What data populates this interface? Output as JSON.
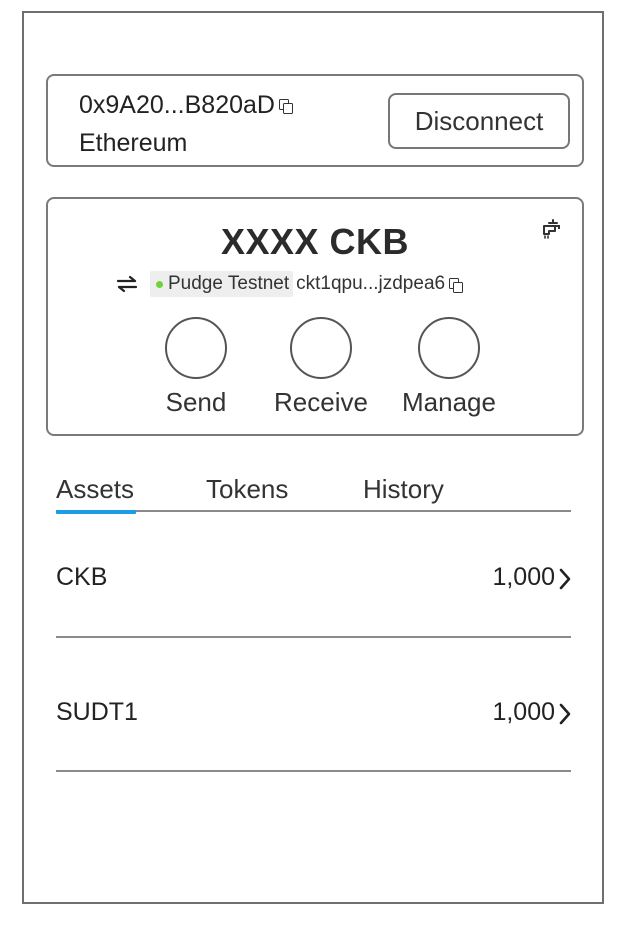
{
  "account": {
    "address": "0x9A20...B820aD",
    "chain": "Ethereum",
    "disconnect_label": "Disconnect"
  },
  "wallet": {
    "balance": "XXXX CKB",
    "network": "Pudge Testnet",
    "network_status_color": "#6ed33a",
    "ckb_address": "ckt1qpu...jzdpea6",
    "actions": [
      {
        "label": "Send",
        "icon": "send-circle"
      },
      {
        "label": "Receive",
        "icon": "receive-circle"
      },
      {
        "label": "Manage",
        "icon": "manage-circle"
      }
    ]
  },
  "tabs": [
    {
      "label": "Assets",
      "active": true
    },
    {
      "label": "Tokens",
      "active": false
    },
    {
      "label": "History",
      "active": false
    }
  ],
  "tab_accent": "#1e9be8",
  "assets": [
    {
      "name": "CKB",
      "value": "1,000"
    },
    {
      "name": "SUDT1",
      "value": "1,000"
    }
  ]
}
